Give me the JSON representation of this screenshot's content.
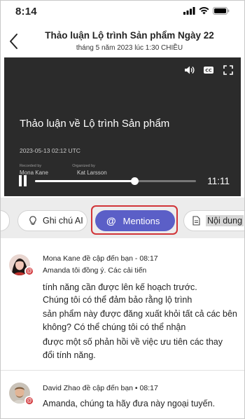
{
  "status_bar": {
    "time": "8:14"
  },
  "header": {
    "title": "Thảo luận Lộ trình Sản phẩm Ngày 22",
    "subtitle": "tháng 5 năm 2023 lúc 1:30 CHIỀU"
  },
  "video": {
    "title": "Thảo luận về Lộ trình Sản phẩm",
    "date": "2023-05-13 02:12 UTC",
    "recorded_by_label": "Recorded by",
    "recorded_by": "Mona Kane",
    "organized_by_label": "Organized by",
    "organized_by": "Kat Larsson",
    "duration": "11:11",
    "progress": 0.62
  },
  "tabs": {
    "notes": "Ghi chú AI",
    "mentions": "Mentions",
    "content": "Nội dung"
  },
  "mentions": [
    {
      "header": "Mona Kane đề cập đến bạn - 08:17",
      "lines": [
        "Amanda tôi đồng ý. Các cải tiến",
        "tính năng cần được lên kế hoạch trước.",
        "Chúng tôi có thể đảm bảo rằng lộ trình",
        "sản phẩm này được đăng xuất khỏi tất cả các bên",
        "không? Có thể chúng tôi có thể nhận",
        "được một số phản hồi về việc ưu tiên các thay",
        "đổi tính năng."
      ]
    },
    {
      "header": "David Zhao đề cập đến bạn • 08:17",
      "lines": [
        "Amanda, chúng ta hãy đưa này ngoại tuyến."
      ]
    }
  ],
  "colors": {
    "accent": "#5b5fc7",
    "highlight": "#d13438",
    "mention_badge": "#d13438"
  }
}
